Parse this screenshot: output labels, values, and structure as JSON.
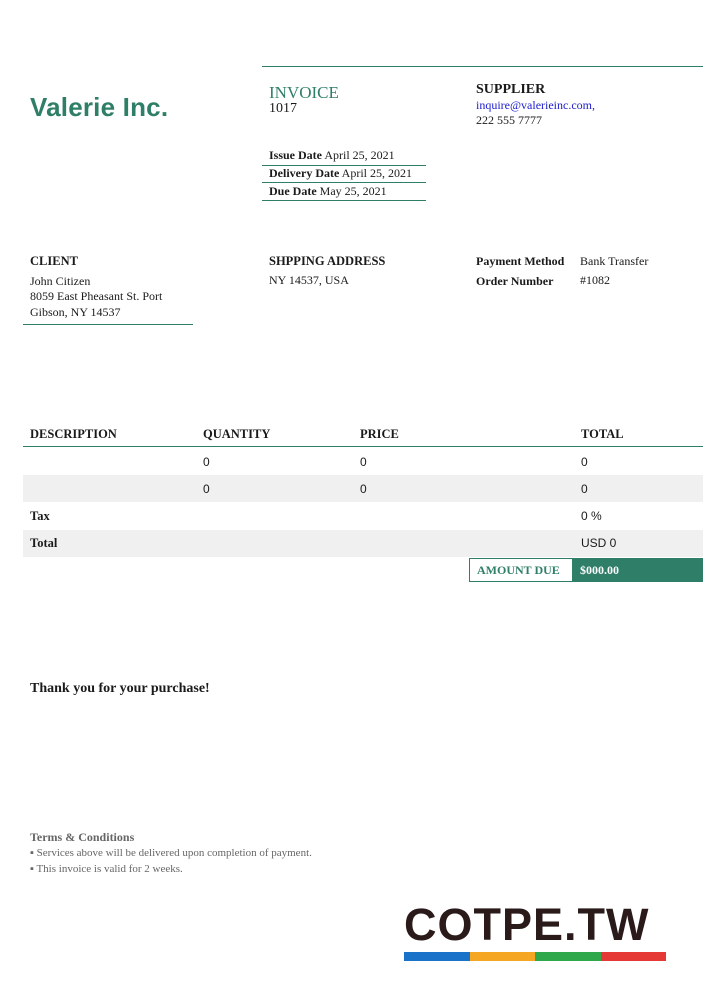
{
  "header": {
    "company": "Valerie Inc.",
    "invoice_title": "INVOICE",
    "invoice_number": "1017",
    "supplier_title": "SUPPLIER",
    "supplier_email": "inquire@valerieinc.com,",
    "supplier_phone": "222 555 7777"
  },
  "dates": [
    {
      "label": "Issue Date",
      "value": "April 25, 2021"
    },
    {
      "label": "Delivery Date",
      "value": "April 25, 2021"
    },
    {
      "label": "Due Date",
      "value": "May 25, 2021"
    }
  ],
  "client": {
    "title": "CLIENT",
    "name": "John Citizen",
    "street": "8059 East Pheasant St. Port",
    "city": "Gibson, NY 14537"
  },
  "shipping": {
    "title": "SHPPING ADDRESS",
    "address": "NY 14537, USA"
  },
  "payment": {
    "method_label": "Payment Method",
    "method_value": "Bank Transfer",
    "order_label": "Order Number",
    "order_value": "#1082"
  },
  "table": {
    "headers": [
      "DESCRIPTION",
      "QUANTITY",
      "PRICE",
      "TOTAL"
    ],
    "rows": [
      {
        "description": "",
        "quantity": "0",
        "price": "0",
        "total": "0"
      },
      {
        "description": "",
        "quantity": "0",
        "price": "0",
        "total": "0"
      }
    ],
    "tax_label": "Tax",
    "tax_value": "0 %",
    "total_label": "Total",
    "total_value": "USD 0",
    "amount_due_label": "AMOUNT DUE",
    "amount_due_value": "$000.00"
  },
  "footer": {
    "thanks": "Thank you for your purchase!",
    "terms_title": "Terms & Conditions",
    "terms": [
      "▪ Services above will be delivered upon completion of payment.",
      "▪ This invoice is valid for 2 weeks."
    ]
  },
  "watermark": {
    "text": "COTPE.TW",
    "bar_colors": [
      "#1a73c9",
      "#f5a623",
      "#2ea84a",
      "#e53935"
    ]
  },
  "colors": {
    "accent": "#2f7f68"
  }
}
